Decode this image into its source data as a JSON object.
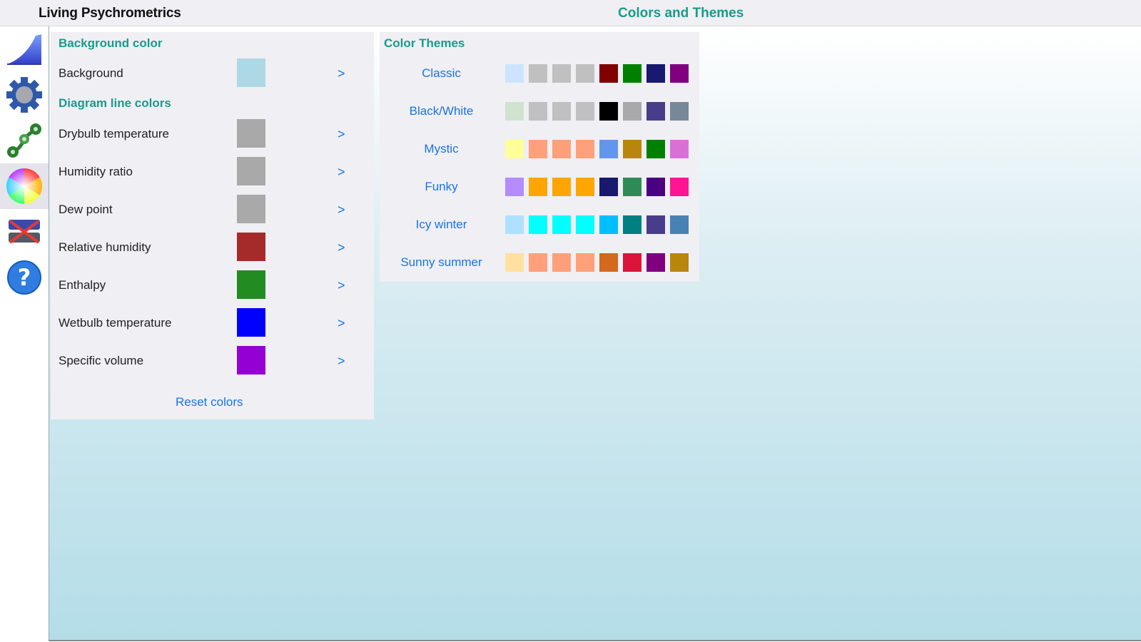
{
  "header": {
    "app_title": "Living Psychrometrics",
    "page_title": "Colors and Themes"
  },
  "sidebar": {
    "items": [
      {
        "name": "chart-icon"
      },
      {
        "name": "gear-icon"
      },
      {
        "name": "process-icon"
      },
      {
        "name": "color-wheel-icon",
        "active": true
      },
      {
        "name": "compare-icon"
      },
      {
        "name": "help-icon"
      }
    ]
  },
  "background_section": {
    "title": "Background color",
    "rows": [
      {
        "label": "Background",
        "color": "#add8e6",
        "chevron": ">"
      }
    ]
  },
  "line_section": {
    "title": "Diagram line colors",
    "rows": [
      {
        "label": "Drybulb temperature",
        "color": "#a9a9a9",
        "chevron": ">"
      },
      {
        "label": "Humidity ratio",
        "color": "#a9a9a9",
        "chevron": ">"
      },
      {
        "label": "Dew point",
        "color": "#a9a9a9",
        "chevron": ">"
      },
      {
        "label": "Relative humidity",
        "color": "#a52a2a",
        "chevron": ">"
      },
      {
        "label": "Enthalpy",
        "color": "#228b22",
        "chevron": ">"
      },
      {
        "label": "Wetbulb temperature",
        "color": "#0000ff",
        "chevron": ">"
      },
      {
        "label": "Specific volume",
        "color": "#9400d3",
        "chevron": ">"
      }
    ]
  },
  "reset_label": "Reset colors",
  "themes": {
    "title": "Color Themes",
    "items": [
      {
        "name": "Classic",
        "colors": [
          "#cce4ff",
          "#c0c0c0",
          "#c0c0c0",
          "#c0c0c0",
          "#800000",
          "#008000",
          "#191970",
          "#800080"
        ]
      },
      {
        "name": "Black/White",
        "colors": [
          "#cfe3cf",
          "#c0c0c0",
          "#c0c0c0",
          "#c0c0c0",
          "#000000",
          "#a9a9a9",
          "#483d8b",
          "#778899"
        ]
      },
      {
        "name": "Mystic",
        "colors": [
          "#fffe99",
          "#ffa07a",
          "#ffa07a",
          "#ffa07a",
          "#6495ed",
          "#b8860b",
          "#008000",
          "#da70d6"
        ]
      },
      {
        "name": "Funky",
        "colors": [
          "#b38cff",
          "#ffa500",
          "#ffa500",
          "#ffa500",
          "#191970",
          "#2e8b57",
          "#4b0082",
          "#ff1493"
        ]
      },
      {
        "name": "Icy winter",
        "colors": [
          "#aee1ff",
          "#00ffff",
          "#00ffff",
          "#00ffff",
          "#00bfff",
          "#008080",
          "#483d8b",
          "#4682b4"
        ]
      },
      {
        "name": "Sunny summer",
        "colors": [
          "#ffe0a0",
          "#ffa07a",
          "#ffa07a",
          "#ffa07a",
          "#d2691e",
          "#dc143c",
          "#800080",
          "#b8860b"
        ]
      }
    ]
  }
}
